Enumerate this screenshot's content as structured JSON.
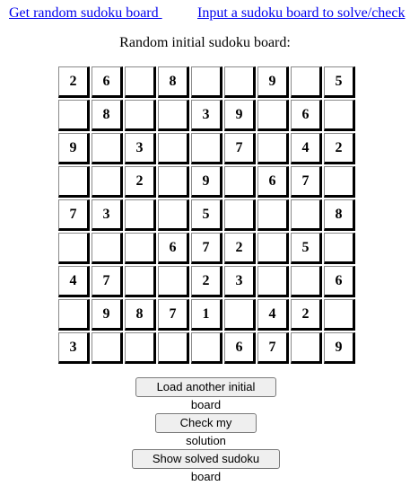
{
  "nav": {
    "random_label": "Get random sudoku board ",
    "input_label": "Input a sudoku board to solve/check"
  },
  "caption": "Random initial sudoku board:",
  "board": [
    [
      "2",
      "6",
      "",
      "8",
      "",
      "",
      "9",
      "",
      "5"
    ],
    [
      "",
      "8",
      "",
      "",
      "3",
      "9",
      "",
      "6",
      ""
    ],
    [
      "9",
      "",
      "3",
      "",
      "",
      "7",
      "",
      "4",
      "2"
    ],
    [
      "",
      "",
      "2",
      "",
      "9",
      "",
      "6",
      "7",
      ""
    ],
    [
      "7",
      "3",
      "",
      "",
      "5",
      "",
      "",
      "",
      "8"
    ],
    [
      "",
      "",
      "",
      "6",
      "7",
      "2",
      "",
      "5",
      ""
    ],
    [
      "4",
      "7",
      "",
      "",
      "2",
      "3",
      "",
      "",
      "6"
    ],
    [
      "",
      "9",
      "8",
      "7",
      "1",
      "",
      "4",
      "2",
      ""
    ],
    [
      "3",
      "",
      "",
      "",
      "",
      "6",
      "7",
      "",
      "9"
    ]
  ],
  "buttons": {
    "load_label": "Load another initial board",
    "check_label": "Check my solution",
    "show_label": "Show solved sudoku board"
  }
}
